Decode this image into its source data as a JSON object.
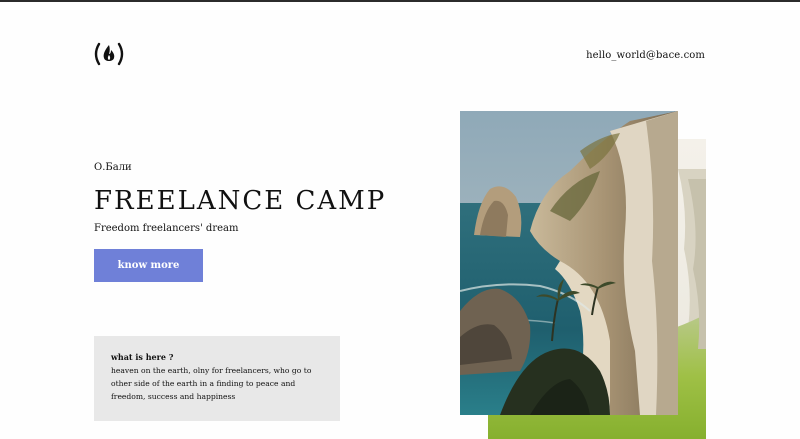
{
  "header": {
    "email": "hello_world@bace.com",
    "logo_icon": "flame-in-parentheses-icon"
  },
  "hero": {
    "location": "О.Бали",
    "title": "FREELANCE CAMP",
    "subtitle": "Freedom freelancers' dream",
    "cta_label": "know more"
  },
  "info": {
    "heading": "what is here ?",
    "text": "heaven on the earth, olny for freelancers, who go to other side of the earth in a finding to peace and freedom, success and happiness"
  },
  "colors": {
    "accent": "#6f80d8",
    "info_bg": "#e8e8e8",
    "text": "#111111"
  }
}
